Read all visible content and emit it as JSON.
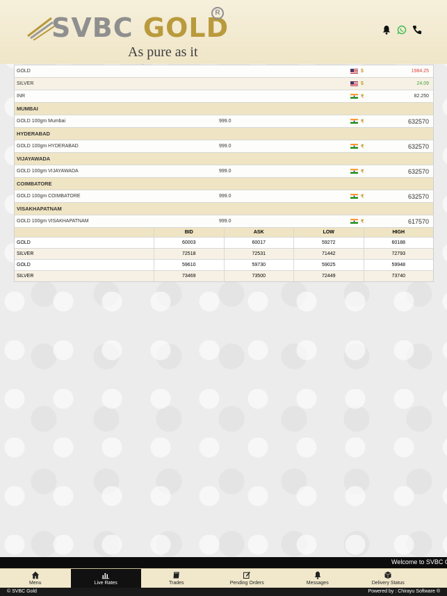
{
  "brand": {
    "name_grey": "SVBC",
    "name_gold": "GOLD",
    "registered": "R",
    "tagline": "As pure as it gets..."
  },
  "header_icons": [
    "bell-icon",
    "whatsapp-icon",
    "phone-icon"
  ],
  "spot": [
    {
      "name": "GOLD",
      "flag": "us",
      "currency": "$",
      "value": "1984.25",
      "color": "red"
    },
    {
      "name": "SILVER",
      "flag": "us",
      "currency": "$",
      "value": "24.09",
      "color": "green"
    },
    {
      "name": "INR",
      "flag": "in",
      "currency": "₹",
      "value": "82.250",
      "color": "normal"
    }
  ],
  "cities": [
    {
      "title": "MUMBAI",
      "item": "GOLD 100gm Mumbai",
      "purity": "999.0",
      "value": "632570"
    },
    {
      "title": "HYDERABAD",
      "item": "GOLD 100gm HYDERABAD",
      "purity": "999.0",
      "value": "632570"
    },
    {
      "title": "VIJAYAWADA",
      "item": "GOLD 100gm VIJAYAWADA",
      "purity": "999.0",
      "value": "632570"
    },
    {
      "title": "COIMBATORE",
      "item": "GOLD 100gm COIMBATORE",
      "purity": "999.0",
      "value": "632570"
    },
    {
      "title": "VISAKHAPATNAM",
      "item": "GOLD 100gm VISAKHAPATNAM",
      "purity": "999.0",
      "value": "617570"
    }
  ],
  "grid": {
    "headers": [
      "",
      "BID",
      "ASK",
      "LOW",
      "HIGH"
    ],
    "rows": [
      [
        "GOLD",
        "60003",
        "60017",
        "59272",
        "60188"
      ],
      [
        "SILVER",
        "72518",
        "72531",
        "71442",
        "72793"
      ],
      [
        "GOLD",
        "59610",
        "59730",
        "59025",
        "59948"
      ],
      [
        "SILVER",
        "73469",
        "73500",
        "72449",
        "73740"
      ]
    ]
  },
  "ticker": "Welcome to SVBC G",
  "nav": [
    {
      "label": "Menu",
      "icon": "home-icon",
      "active": false
    },
    {
      "label": "Live Rates",
      "icon": "bar-chart-icon",
      "active": true
    },
    {
      "label": "Trades",
      "icon": "book-icon",
      "active": false
    },
    {
      "label": "Pending Orders",
      "icon": "edit-icon",
      "active": false
    },
    {
      "label": "Messages",
      "icon": "bell-icon",
      "active": false
    },
    {
      "label": "Delivery Status",
      "icon": "cube-icon",
      "active": false
    }
  ],
  "footer": {
    "left": "© SVBC Gold",
    "right": "Powered by : Chirayu Software ®"
  }
}
